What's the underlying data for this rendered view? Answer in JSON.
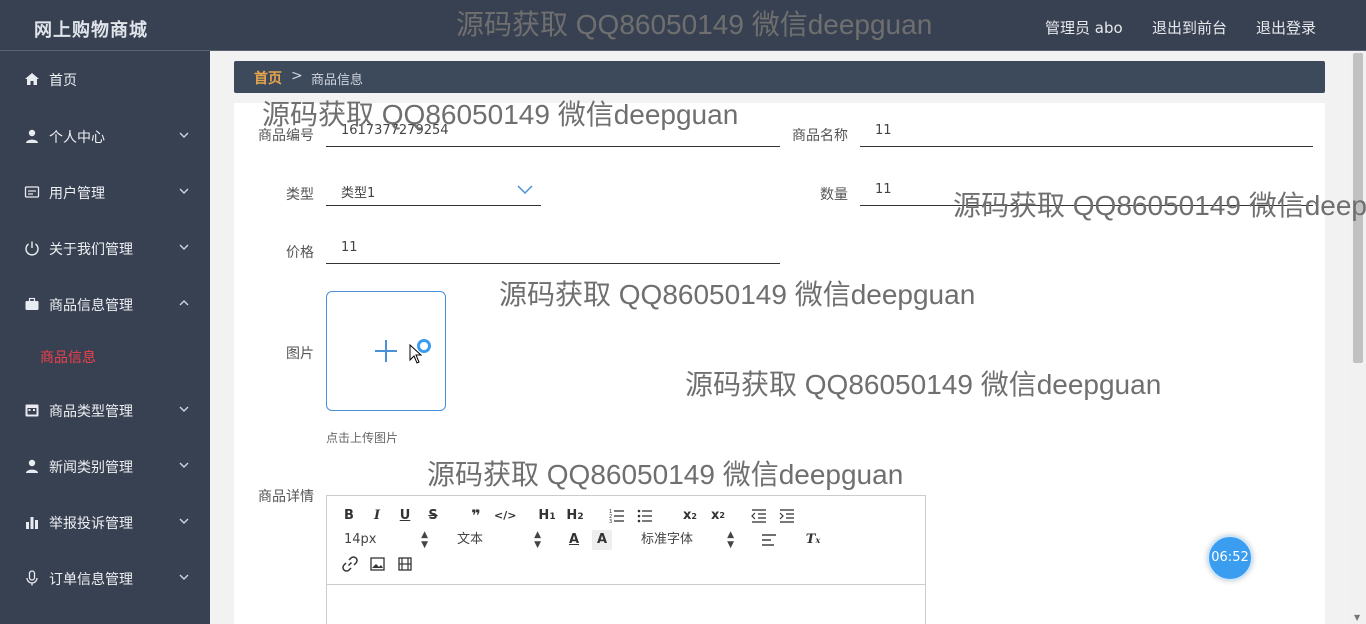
{
  "header": {
    "brand": "网上购物商城",
    "admin": "管理员 abo",
    "to_front": "退出到前台",
    "logout": "退出登录"
  },
  "sidebar": {
    "items": [
      {
        "label": "首页",
        "icon": "home-icon"
      },
      {
        "label": "个人中心",
        "icon": "user-icon"
      },
      {
        "label": "用户管理",
        "icon": "id-card-icon"
      },
      {
        "label": "关于我们管理",
        "icon": "power-icon"
      },
      {
        "label": "商品信息管理",
        "icon": "briefcase-icon"
      },
      {
        "label": "商品类型管理",
        "icon": "calendar-icon"
      },
      {
        "label": "新闻类别管理",
        "icon": "person-icon"
      },
      {
        "label": "举报投诉管理",
        "icon": "bar-chart-icon"
      },
      {
        "label": "订单信息管理",
        "icon": "microphone-icon"
      }
    ],
    "sub_item": "商品信息"
  },
  "breadcrumb": {
    "home": "首页",
    "separator": ">",
    "current": "商品信息"
  },
  "form": {
    "code_label": "商品编号",
    "code_value": "1617377279254",
    "name_label": "商品名称",
    "name_value": "11",
    "type_label": "类型",
    "type_value": "类型1",
    "qty_label": "数量",
    "qty_value": "11",
    "price_label": "价格",
    "price_value": "11",
    "image_label": "图片",
    "upload_tip": "点击上传图片",
    "detail_label": "商品详情"
  },
  "editor": {
    "font_size": "14px",
    "text_style": "文本",
    "font_family": "标准字体"
  },
  "timer": "06:52",
  "watermark": "源码获取 QQ86050149 微信deepguan",
  "colors": {
    "sidebar_bg": "#384152",
    "accent_red": "#f0404a",
    "breadcrumb_home": "#e8a54a",
    "upload_border": "#4a90d9"
  }
}
